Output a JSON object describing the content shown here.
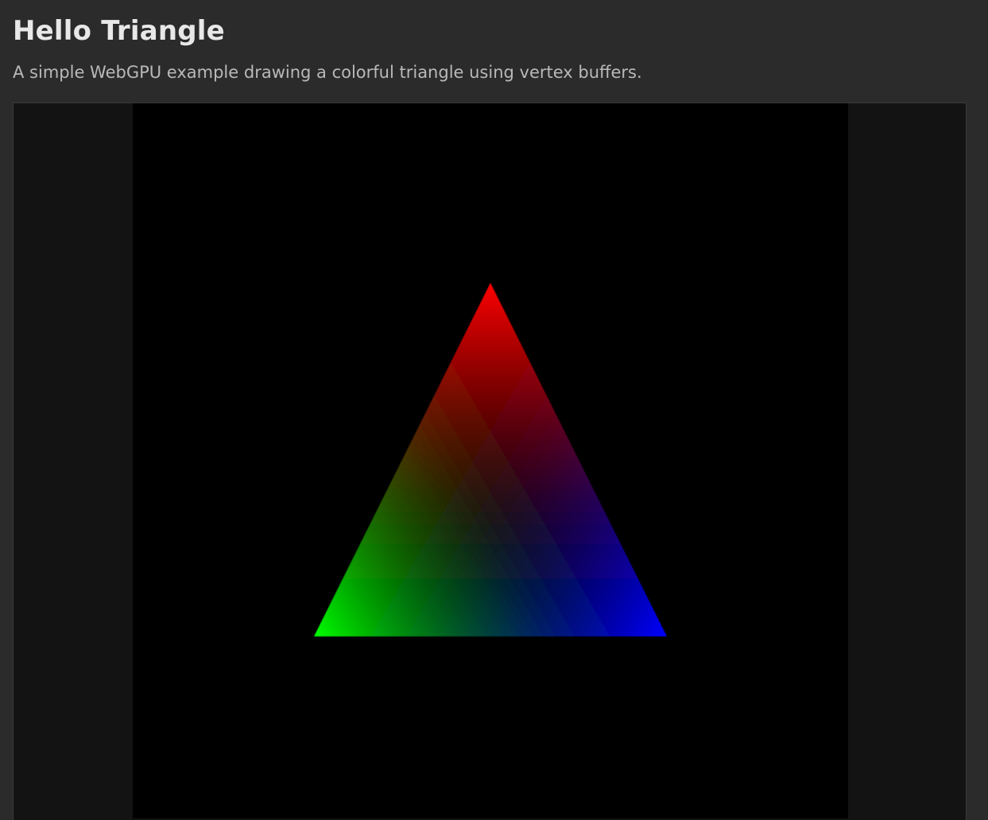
{
  "header": {
    "title": "Hello Triangle",
    "description": "A simple WebGPU example drawing a colorful triangle using vertex buffers."
  },
  "scene": {
    "clear_color": "#000000",
    "vertices": [
      {
        "name": "top",
        "color": "#ff0000"
      },
      {
        "name": "bottom-left",
        "color": "#00ff00"
      },
      {
        "name": "bottom-right",
        "color": "#0000ff"
      }
    ]
  }
}
